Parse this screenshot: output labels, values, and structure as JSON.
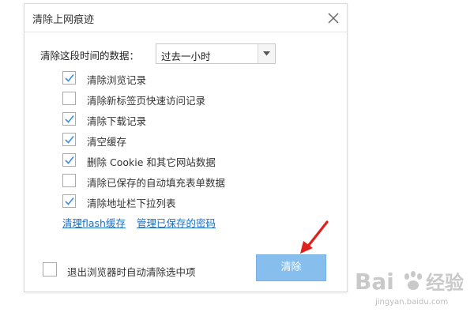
{
  "dialog": {
    "title": "清除上网痕迹",
    "range_label": "清除这段时间的数据：",
    "range_value": "过去一小时",
    "options": [
      {
        "label": "清除浏览记录",
        "checked": true
      },
      {
        "label": "清除新标签页快速访问记录",
        "checked": false
      },
      {
        "label": "清除下载记录",
        "checked": true
      },
      {
        "label": "清空缓存",
        "checked": true
      },
      {
        "label": "删除 Cookie 和其它网站数据",
        "checked": true
      },
      {
        "label": "清除已保存的自动填充表单数据",
        "checked": false
      },
      {
        "label": "清除地址栏下拉列表",
        "checked": true
      }
    ],
    "links": [
      "清理flash缓存",
      "管理已保存的密码"
    ],
    "auto_clear_label": "退出浏览器时自动清除选中项",
    "auto_clear_checked": false,
    "clear_button": "清除"
  },
  "watermark": {
    "brand": "Bai度经验",
    "url": "jingyan.baidu.com"
  },
  "colors": {
    "accent": "#86bfee",
    "link": "#1f6fc2",
    "check": "#3a8ee6",
    "arrow": "#e0201c"
  }
}
